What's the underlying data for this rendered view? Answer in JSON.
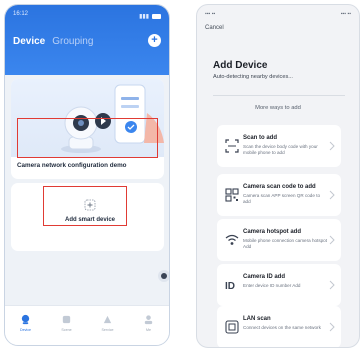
{
  "left_phone": {
    "status_time": "16:12 ",
    "tabs": {
      "active": "Device",
      "other": "Grouping"
    },
    "demo_card_label": "Camera network configuration demo",
    "add_device_label": "Add smart device",
    "bottom_tabs": [
      {
        "label": "Device",
        "active": true
      },
      {
        "label": "Scene",
        "active": false
      },
      {
        "label": "Service",
        "active": false
      },
      {
        "label": "Me",
        "active": false
      }
    ],
    "accent": "#2b74e0",
    "highlight_color": "#e03b34"
  },
  "right_phone": {
    "cancel_label": "Cancel",
    "title": "Add Device",
    "subtitle": "Auto-detecting nearby devices...",
    "more_ways": "More ways to add",
    "options": [
      {
        "icon": "scan-icon",
        "title": "Scan to add",
        "desc": "Scan the device body code with your mobile phone to add"
      },
      {
        "icon": "qr-code-icon",
        "title": "Camera scan code to add",
        "desc": "Camera scan APP screen QR code to add"
      },
      {
        "icon": "wifi-icon",
        "title": "Camera hotspot add",
        "desc": "Mobile phone connection camera hotspot Add"
      },
      {
        "icon": "id-icon",
        "title": "Camera ID add",
        "desc": "Enter device ID number Add"
      },
      {
        "icon": "lan-icon",
        "title": "LAN scan",
        "desc": "Connect devices on the same network"
      }
    ]
  }
}
